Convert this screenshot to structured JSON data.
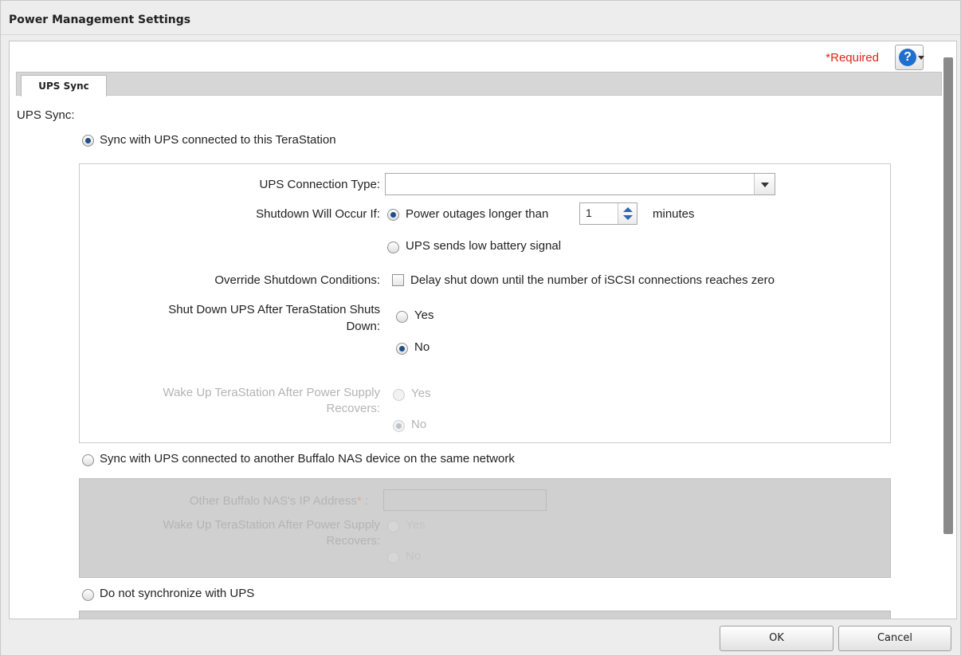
{
  "dialog": {
    "title": "Power Management Settings"
  },
  "header": {
    "required_label": "*Required",
    "help_icon_text": "?"
  },
  "tabs": [
    {
      "label": "UPS Sync",
      "active": true
    }
  ],
  "ups_sync_heading": "UPS Sync:",
  "options": {
    "sync_local": {
      "label": "Sync with UPS connected to this TeraStation",
      "selected": true
    },
    "sync_network": {
      "label": "Sync with UPS connected to another Buffalo NAS device on the same network",
      "selected": false
    },
    "no_sync": {
      "label": "Do not synchronize with UPS",
      "selected": false
    }
  },
  "local_panel": {
    "connection_type": {
      "label": "UPS Connection Type:",
      "value": ""
    },
    "shutdown_if": {
      "label": "Shutdown Will Occur If:",
      "option_outage": "Power outages longer than",
      "minutes_value": "1",
      "minutes_unit": "minutes",
      "option_low_battery": "UPS sends low battery signal",
      "selected": "outage"
    },
    "override": {
      "label": "Override Shutdown Conditions:",
      "checkbox_label": "Delay shut down until the number of iSCSI connections reaches zero",
      "checked": false
    },
    "shutdown_ups": {
      "label_line1": "Shut Down UPS After TeraStation Shuts",
      "label_line2": "Down:",
      "yes": "Yes",
      "no": "No",
      "selected": "no"
    },
    "wake_up": {
      "label_line1": "Wake Up TeraStation After Power Supply",
      "label_line2": "Recovers:",
      "yes": "Yes",
      "no": "No",
      "selected": "no",
      "disabled": true
    }
  },
  "network_panel": {
    "ip_label": "Other Buffalo NAS's IP Address",
    "ip_required_mark": "*",
    "ip_colon": " :",
    "ip_value": "",
    "wake_up": {
      "label_line1": "Wake Up TeraStation After Power Supply",
      "label_line2": "Recovers:",
      "yes": "Yes",
      "no": "No"
    }
  },
  "footer": {
    "ok_label": "OK",
    "cancel_label": "Cancel"
  }
}
